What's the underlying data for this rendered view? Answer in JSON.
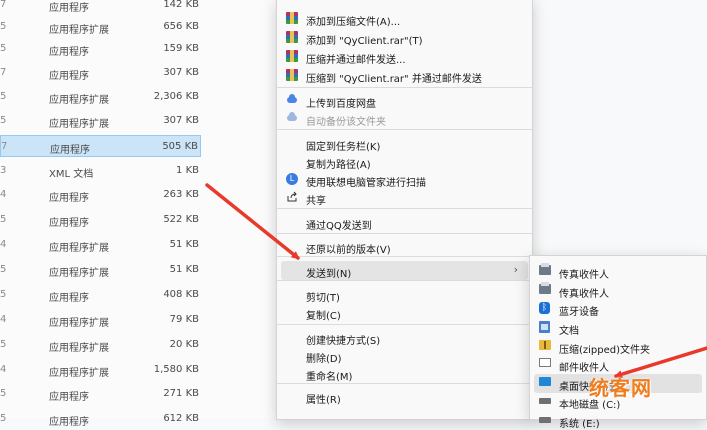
{
  "file_list": [
    {
      "idx": "7",
      "type": "应用程序",
      "size": "142 KB",
      "selected": false
    },
    {
      "idx": "5",
      "type": "应用程序扩展",
      "size": "656 KB",
      "selected": false
    },
    {
      "idx": "5",
      "type": "应用程序",
      "size": "159 KB",
      "selected": false
    },
    {
      "idx": "7",
      "type": "应用程序",
      "size": "307 KB",
      "selected": false
    },
    {
      "idx": "5",
      "type": "应用程序扩展",
      "size": "2,306 KB",
      "selected": false
    },
    {
      "idx": "5",
      "type": "应用程序扩展",
      "size": "307 KB",
      "selected": false
    },
    {
      "idx": "7",
      "type": "应用程序",
      "size": "505 KB",
      "selected": true
    },
    {
      "idx": "3",
      "type": "XML 文档",
      "size": "1 KB",
      "selected": false
    },
    {
      "idx": "4",
      "type": "应用程序",
      "size": "263 KB",
      "selected": false
    },
    {
      "idx": "5",
      "type": "应用程序",
      "size": "522 KB",
      "selected": false
    },
    {
      "idx": "4",
      "type": "应用程序扩展",
      "size": "51 KB",
      "selected": false
    },
    {
      "idx": "5",
      "type": "应用程序扩展",
      "size": "51 KB",
      "selected": false
    },
    {
      "idx": "5",
      "type": "应用程序",
      "size": "408 KB",
      "selected": false
    },
    {
      "idx": "4",
      "type": "应用程序扩展",
      "size": "79 KB",
      "selected": false
    },
    {
      "idx": "5",
      "type": "应用程序扩展",
      "size": "20 KB",
      "selected": false
    },
    {
      "idx": "4",
      "type": "应用程序扩展",
      "size": "1,580 KB",
      "selected": false
    },
    {
      "idx": "5",
      "type": "应用程序",
      "size": "271 KB",
      "selected": false
    },
    {
      "idx": "5",
      "type": "应用程序",
      "size": "612 KB",
      "selected": false
    }
  ],
  "context_menu": {
    "items": [
      {
        "label": "添加到压缩文件(A)...",
        "icon": "winrar-icon"
      },
      {
        "label": "添加到 \"QyClient.rar\"(T)",
        "icon": "winrar-icon"
      },
      {
        "label": "压缩并通过邮件发送...",
        "icon": "winrar-icon"
      },
      {
        "label": "压缩到 \"QyClient.rar\" 并通过邮件发送",
        "icon": "winrar-icon"
      },
      {
        "label": "上传到百度网盘",
        "icon": "baidu-cloud-icon"
      },
      {
        "label": "自动备份该文件夹",
        "icon": "baidu-cloud-icon",
        "disabled": true
      },
      {
        "label": "固定到任务栏(K)"
      },
      {
        "label": "复制为路径(A)"
      },
      {
        "label": "使用联想电脑管家进行扫描",
        "icon": "lenovo-icon"
      },
      {
        "label": "共享",
        "icon": "share-icon"
      },
      {
        "label": "通过QQ发送到"
      },
      {
        "label": "还原以前的版本(V)"
      },
      {
        "label": "发送到(N)",
        "submenu": true
      },
      {
        "label": "剪切(T)"
      },
      {
        "label": "复制(C)"
      },
      {
        "label": "创建快捷方式(S)"
      },
      {
        "label": "删除(D)"
      },
      {
        "label": "重命名(M)"
      },
      {
        "label": "属性(R)"
      }
    ],
    "submenu_arrow": "›"
  },
  "send_to_menu": {
    "items": [
      {
        "label": "传真收件人",
        "icon": "fax-icon"
      },
      {
        "label": "传真收件人",
        "icon": "fax-icon"
      },
      {
        "label": "蓝牙设备",
        "icon": "bluetooth-icon"
      },
      {
        "label": "文档",
        "icon": "documents-icon"
      },
      {
        "label": "压缩(zipped)文件夹",
        "icon": "zip-folder-icon"
      },
      {
        "label": "邮件收件人",
        "icon": "mail-icon"
      },
      {
        "label": "桌面快捷方式",
        "icon": "desktop-icon"
      },
      {
        "label": "本地磁盘 (C:)",
        "icon": "disk-icon"
      },
      {
        "label": "系统 (E:)",
        "icon": "disk-icon"
      }
    ]
  },
  "watermark": "统客网",
  "colors": {
    "selection": "#cce4f7",
    "arrow": "#e8392a",
    "watermark": "#f07d1c"
  }
}
